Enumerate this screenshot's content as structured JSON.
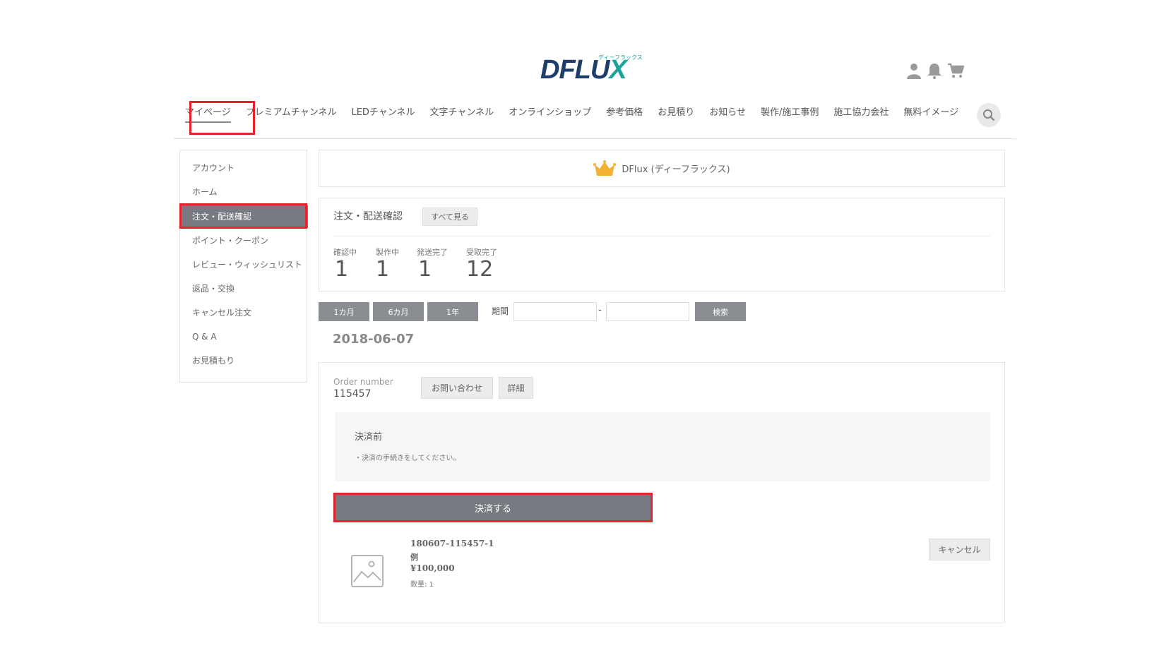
{
  "header": {
    "logo_text_main": "DFLU",
    "logo_text_x": "X",
    "logo_sub": "ディーフラックス",
    "icons": [
      "user-icon",
      "bell-icon",
      "cart-icon"
    ]
  },
  "nav": {
    "items": [
      "マイページ",
      "プレミアムチャンネル",
      "LEDチャンネル",
      "文字チャンネル",
      "オンラインショップ",
      "参考価格",
      "お見積り",
      "お知らせ",
      "製作/施工事例",
      "施工協力会社",
      "無料イメージ"
    ],
    "active": "マイページ"
  },
  "sidebar": {
    "items": [
      "アカウント",
      "ホーム",
      "注文・配送確認",
      "ポイント・クーポン",
      "レビュー・ウィッシュリスト",
      "返品・交換",
      "キャンセル注文",
      "Q & A",
      "お見積もり"
    ],
    "active": "注文・配送確認"
  },
  "brand": {
    "name": "DFlux (ディーフラックス)",
    "icon": "crown-icon",
    "icon_color": "#f2b233"
  },
  "status": {
    "title": "注文・配送確認",
    "see_all": "すべて見る",
    "stats": [
      {
        "label": "確認中",
        "value": "1"
      },
      {
        "label": "製作中",
        "value": "1"
      },
      {
        "label": "発送完了",
        "value": "1"
      },
      {
        "label": "受取完了",
        "value": "12"
      }
    ]
  },
  "filter": {
    "periods": [
      "1カ月",
      "6カ月",
      "1年"
    ],
    "period_label": "期間",
    "date_from": "",
    "date_to": "",
    "separator": "-",
    "search_label": "検索"
  },
  "order": {
    "date": "2018-06-07",
    "number_label": "Order number",
    "number": "115457",
    "inquiry_label": "お問い合わせ",
    "detail_label": "詳細",
    "payment_status": "決済前",
    "payment_note": "・決済の手続きをしてください。",
    "pay_button": "決済する",
    "item": {
      "code": "180607-115457-1",
      "name": "例",
      "price": "¥100,000",
      "quantity": "数量: 1",
      "cancel_label": "キャンセル"
    }
  },
  "colors": {
    "highlight": "#e4232d",
    "accent_gray": "#777a80",
    "logo_navy": "#1f3d6b",
    "logo_teal": "#1aa39a"
  }
}
